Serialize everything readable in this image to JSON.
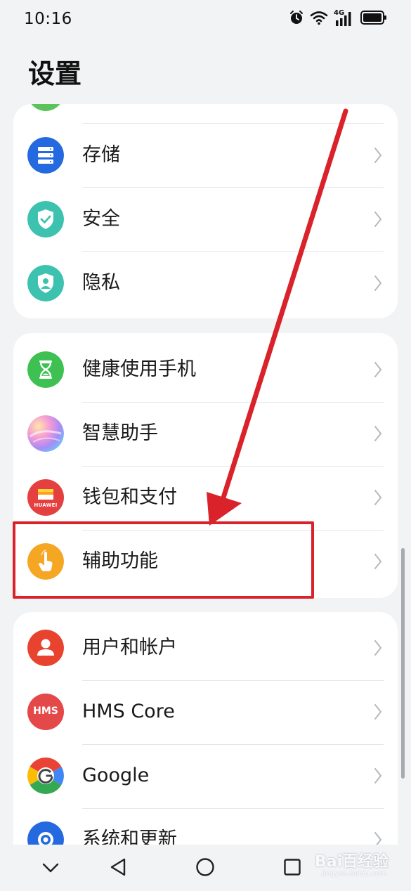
{
  "status_bar": {
    "time": "10:16",
    "network_label": "4G",
    "icons": [
      "alarm-icon",
      "wifi-icon",
      "signal-icon",
      "battery-icon"
    ]
  },
  "page_title": "设置",
  "groups": [
    {
      "items": [
        {
          "label": "存储",
          "icon": "storage-icon",
          "color": "#2569e0"
        },
        {
          "label": "安全",
          "icon": "shield-check-icon",
          "color": "#3dc2b0"
        },
        {
          "label": "隐私",
          "icon": "privacy-shield-icon",
          "color": "#3dc2b0"
        }
      ]
    },
    {
      "items": [
        {
          "label": "健康使用手机",
          "icon": "hourglass-icon",
          "color": "#3ec152"
        },
        {
          "label": "智慧助手",
          "icon": "assistant-orb-icon",
          "color": "#e58fd4"
        },
        {
          "label": "钱包和支付",
          "icon": "wallet-icon",
          "color": "#e54040",
          "icon_text": "HUAWEI"
        },
        {
          "label": "辅助功能",
          "icon": "accessibility-hand-icon",
          "color": "#f5a623"
        }
      ]
    },
    {
      "items": [
        {
          "label": "用户和帐户",
          "icon": "user-icon",
          "color": "#e8432e"
        },
        {
          "label": "HMS Core",
          "icon": "hms-core-icon",
          "color": "#e54848",
          "icon_text": "HMS"
        },
        {
          "label": "Google",
          "icon": "google-icon",
          "color": "#4285f4"
        },
        {
          "label": "系统和更新",
          "icon": "system-gear-icon",
          "color": "#2569e0"
        }
      ]
    }
  ],
  "nav_bar": {
    "buttons": [
      "collapse-chevron-icon",
      "back-triangle-icon",
      "home-circle-icon",
      "recents-square-icon"
    ]
  },
  "annotation": {
    "color": "#d9222a",
    "target_label": "辅助功能"
  },
  "watermark": {
    "text": "Bai百经验",
    "subtext": "jingyan.baidu.com"
  }
}
